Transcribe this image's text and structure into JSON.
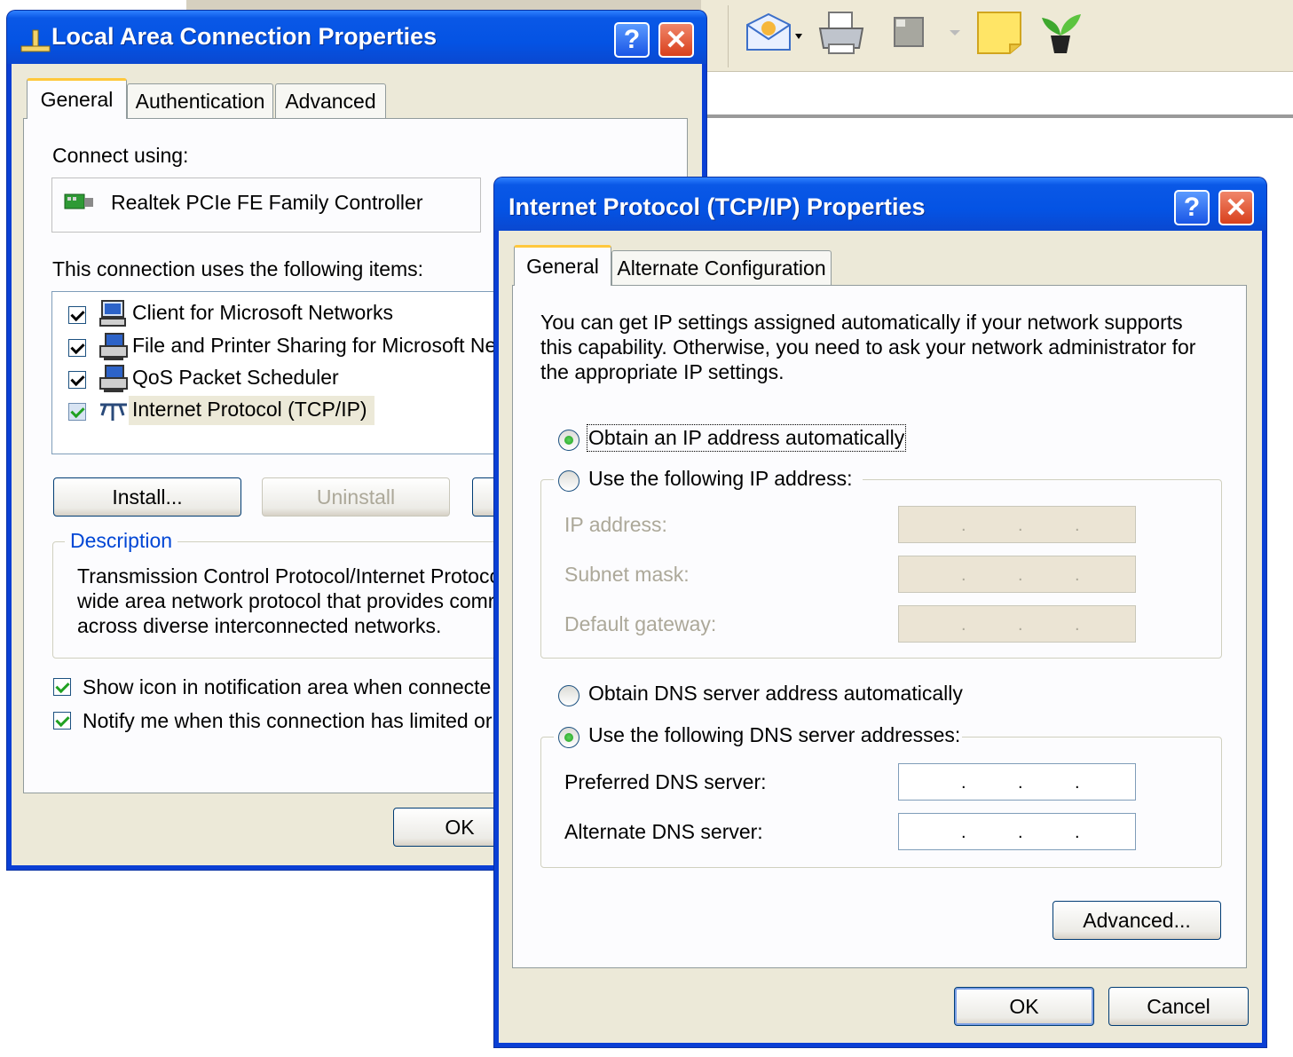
{
  "lan_dialog": {
    "title": "Local Area Connection Properties",
    "tabs": [
      "General",
      "Authentication",
      "Advanced"
    ],
    "connect_using_label": "Connect using:",
    "adapter_name": "Realtek PCIe FE Family Controller",
    "items_label": "This connection uses the following items:",
    "items": [
      {
        "label": "Client for Microsoft Networks",
        "checked": true
      },
      {
        "label": "File and Printer Sharing for Microsoft Net",
        "checked": true
      },
      {
        "label": "QoS Packet Scheduler",
        "checked": true
      },
      {
        "label": "Internet Protocol (TCP/IP)",
        "checked": true
      }
    ],
    "install_label": "Install...",
    "uninstall_label": "Uninstall",
    "description_label": "Description",
    "description_lines": [
      "Transmission Control Protocol/Internet Protoco",
      "wide area network protocol that provides comr",
      "across diverse interconnected networks."
    ],
    "show_icon_label": "Show icon in notification area when connecte",
    "notify_label": "Notify me when this connection has limited or",
    "ok_label": "OK"
  },
  "tcpip_dialog": {
    "title": "Internet Protocol (TCP/IP) Properties",
    "tabs": [
      "General",
      "Alternate Configuration"
    ],
    "intro_lines": [
      "You can get IP settings assigned automatically if your network supports",
      "this capability. Otherwise, you need to ask your network administrator for",
      "the appropriate IP settings."
    ],
    "obtain_ip_auto": "Obtain an IP address automatically",
    "use_following_ip": "Use the following IP address:",
    "ip_address_label": "IP address:",
    "subnet_mask_label": "Subnet mask:",
    "default_gateway_label": "Default gateway:",
    "obtain_dns_auto": "Obtain DNS server address automatically",
    "use_following_dns": "Use the following DNS server addresses:",
    "preferred_dns_label": "Preferred DNS server:",
    "alternate_dns_label": "Alternate DNS server:",
    "ip_dot": ".",
    "advanced_label": "Advanced...",
    "ok_label": "OK",
    "cancel_label": "Cancel"
  },
  "title_buttons": {
    "help": "?",
    "close": "✕"
  }
}
